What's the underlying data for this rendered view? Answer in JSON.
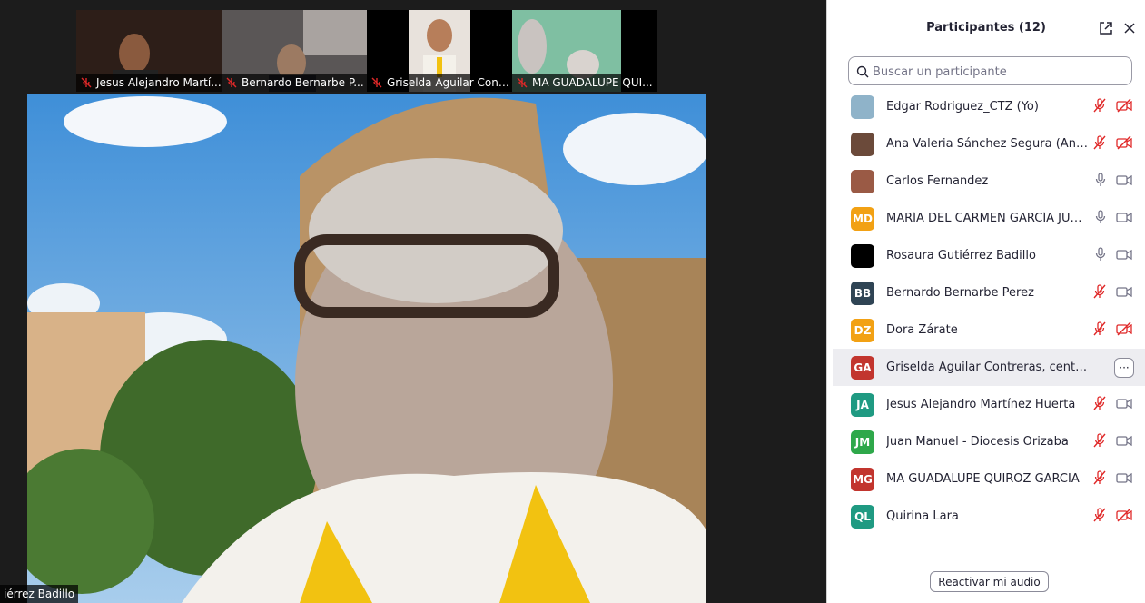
{
  "thumbnails": [
    {
      "name": "Jesus Alejandro Martí...",
      "muted": true
    },
    {
      "name": "Bernardo Bernarbe P...",
      "muted": true
    },
    {
      "name": "Griselda Aguilar Cont...",
      "muted": true
    },
    {
      "name": "MA GUADALUPE QUI...",
      "muted": true
    }
  ],
  "main_video": {
    "speaker_label": "iérrez Badillo"
  },
  "panel": {
    "title": "Participantes (12)",
    "search_placeholder": "Buscar un participante",
    "reactivate_label": "Reactivar mi audio",
    "more_label": "···",
    "participants": [
      {
        "name": "Edgar Rodriguez_CTZ (Yo)",
        "initials": "",
        "avatar_color": "#8fb3c9",
        "mic": "muted",
        "video": "off"
      },
      {
        "name": "Ana Valeria Sánchez Segura (Anfitrión)",
        "initials": "",
        "avatar_color": "#6b4a3a",
        "mic": "muted",
        "video": "off"
      },
      {
        "name": "Carlos Fernandez",
        "initials": "",
        "avatar_color": "#9a5a45",
        "mic": "on",
        "video": "on"
      },
      {
        "name": "MARÍA DEL CARMEN GARCÍA JUÁREZ",
        "initials": "MD",
        "avatar_color": "#f2a114",
        "mic": "on",
        "video": "on"
      },
      {
        "name": "Rosaura Gutiérrez Badillo",
        "initials": "",
        "avatar_color": "#000000",
        "mic": "on",
        "video": "on"
      },
      {
        "name": "Bernardo Bernarbe Perez",
        "initials": "BB",
        "avatar_color": "#2f4454",
        "mic": "muted",
        "video": "on"
      },
      {
        "name": "Dora Zárate",
        "initials": "DZ",
        "avatar_color": "#f2a114",
        "mic": "muted",
        "video": "off"
      },
      {
        "name": "Griselda Aguilar Contreras, centro San Juan",
        "initials": "GA",
        "avatar_color": "#c2352e",
        "mic": "muted",
        "video": "on",
        "hover": true
      },
      {
        "name": "Jesus Alejandro Martínez Huerta",
        "initials": "JA",
        "avatar_color": "#1f9a82",
        "mic": "muted",
        "video": "on"
      },
      {
        "name": "Juan Manuel - Diocesis Orizaba",
        "initials": "JM",
        "avatar_color": "#2ea84a",
        "mic": "muted",
        "video": "on"
      },
      {
        "name": "MA GUADALUPE QUIROZ GARCIA",
        "initials": "MG",
        "avatar_color": "#c2352e",
        "mic": "muted",
        "video": "on"
      },
      {
        "name": "Quirina Lara",
        "initials": "QL",
        "avatar_color": "#1f9a82",
        "mic": "muted",
        "video": "off"
      }
    ]
  }
}
